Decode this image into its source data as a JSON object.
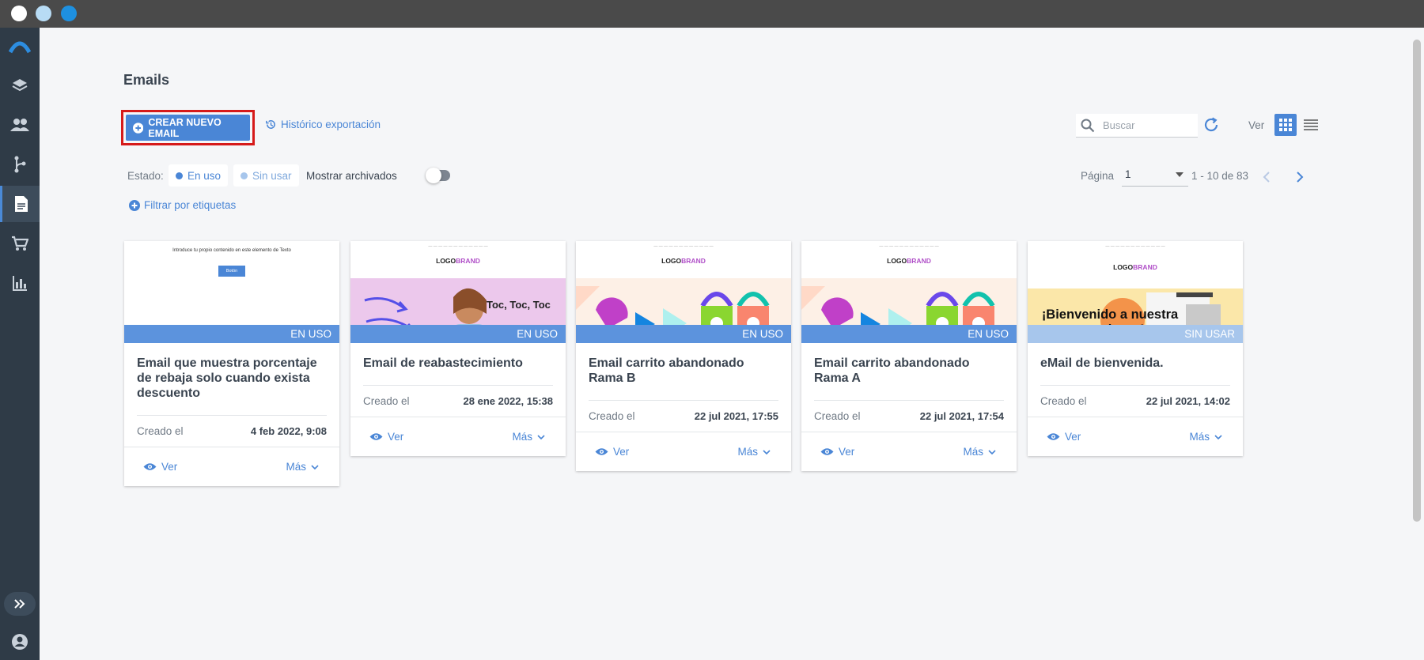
{
  "window": {
    "dots": [
      "#ffffff",
      "#b8dcf5",
      "#1e90e0"
    ]
  },
  "sidebar": {
    "items": [
      "logo-icon",
      "layers-icon",
      "users-icon",
      "flow-icon",
      "document-icon",
      "cart-icon",
      "chart-icon"
    ],
    "active": "document-icon"
  },
  "page": {
    "title": "Emails",
    "create_label": "CREAR NUEVO EMAIL",
    "history_label": "Histórico exportación",
    "search_placeholder": "Buscar",
    "view_label": "Ver",
    "estado_label": "Estado:",
    "en_uso_label": "En uso",
    "sin_usar_label": "Sin usar",
    "archived_label": "Mostrar archivados",
    "page_label": "Página",
    "page_value": "1",
    "range": "1 - 10 de 83",
    "filter_label": "Filtrar por etiquetas"
  },
  "colors": {
    "accent": "#4a86d6",
    "sidebar": "#2f3b47",
    "badge_used": "#5c93dd",
    "badge_unused": "#a7c6ec"
  },
  "cards": [
    {
      "title": "Email que muestra porcentaje de rebaja solo cuando exista descuento",
      "status": "EN USO",
      "created_label": "Creado el",
      "created": "4 feb 2022, 9:08",
      "view": "Ver",
      "more": "Más",
      "thumb_text": "Introduce tu propio contenido en este elemento de Texto",
      "thumb_button": "Botón"
    },
    {
      "title": "Email de reabastecimiento",
      "status": "EN USO",
      "created_label": "Creado el",
      "created": "28 ene 2022, 15:38",
      "view": "Ver",
      "more": "Más",
      "thumb_logo": "LOGO",
      "thumb_brand": "BRAND",
      "thumb_text": "Toc, Toc, Toc"
    },
    {
      "title": "Email carrito abandonado Rama B",
      "status": "EN USO",
      "created_label": "Creado el",
      "created": "22 jul 2021, 17:55",
      "view": "Ver",
      "more": "Más",
      "thumb_logo": "LOGO",
      "thumb_brand": "BRAND"
    },
    {
      "title": "Email carrito abandonado Rama A",
      "status": "EN USO",
      "created_label": "Creado el",
      "created": "22 jul 2021, 17:54",
      "view": "Ver",
      "more": "Más",
      "thumb_logo": "LOGO",
      "thumb_brand": "BRAND"
    },
    {
      "title": "eMail de bienvenida.",
      "status": "SIN USAR",
      "created_label": "Creado el",
      "created": "22 jul 2021, 14:02",
      "view": "Ver",
      "more": "Más",
      "thumb_logo": "LOGO",
      "thumb_brand": "BRAND",
      "thumb_text": "¡Bienvenido a nuestra newsletter!"
    }
  ]
}
